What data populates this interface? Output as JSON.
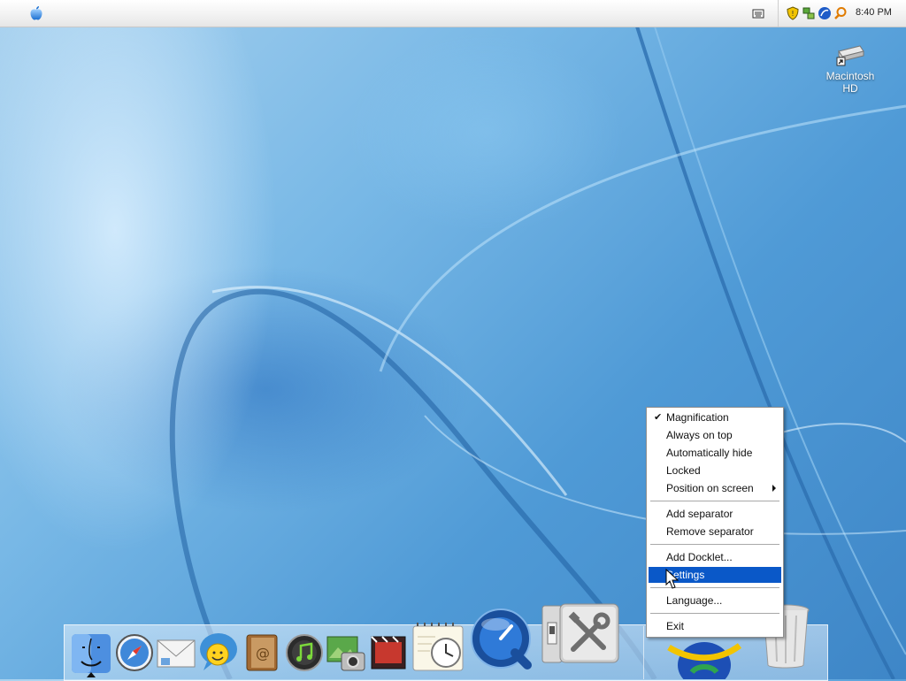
{
  "menubar": {
    "apple_menu": "apple-logo-icon",
    "clock": "8:40 PM",
    "tray_icons": [
      "keyboard-icon",
      "security-shield-icon",
      "network-icon",
      "browser-icon",
      "search-icon"
    ]
  },
  "desktop": {
    "icons": [
      {
        "label": "Macintosh HD",
        "icon": "hard-drive-icon"
      }
    ]
  },
  "dock": {
    "items": [
      "finder-icon",
      "safari-icon",
      "mail-icon",
      "messenger-icon",
      "address-book-icon",
      "itunes-icon",
      "iphoto-icon",
      "imovie-icon",
      "ical-icon",
      "quicktime-icon",
      "switch-icon",
      "settings-tools-icon",
      "network-globe-icon",
      "trash-icon"
    ]
  },
  "context_menu": {
    "items": [
      {
        "label": "Magnification",
        "checked": true
      },
      {
        "label": "Always on top"
      },
      {
        "label": "Automatically hide"
      },
      {
        "label": "Locked"
      },
      {
        "label": "Position on screen",
        "submenu": true
      },
      {
        "label": "Add separator"
      },
      {
        "label": "Remove separator"
      },
      {
        "label": "Add Docklet..."
      },
      {
        "label": "Settings",
        "highlighted": true
      },
      {
        "label": "Language..."
      },
      {
        "label": "Exit"
      }
    ]
  },
  "colors": {
    "menu_highlight": "#0a58c8",
    "desktop_blue": "#4f9ad6"
  }
}
